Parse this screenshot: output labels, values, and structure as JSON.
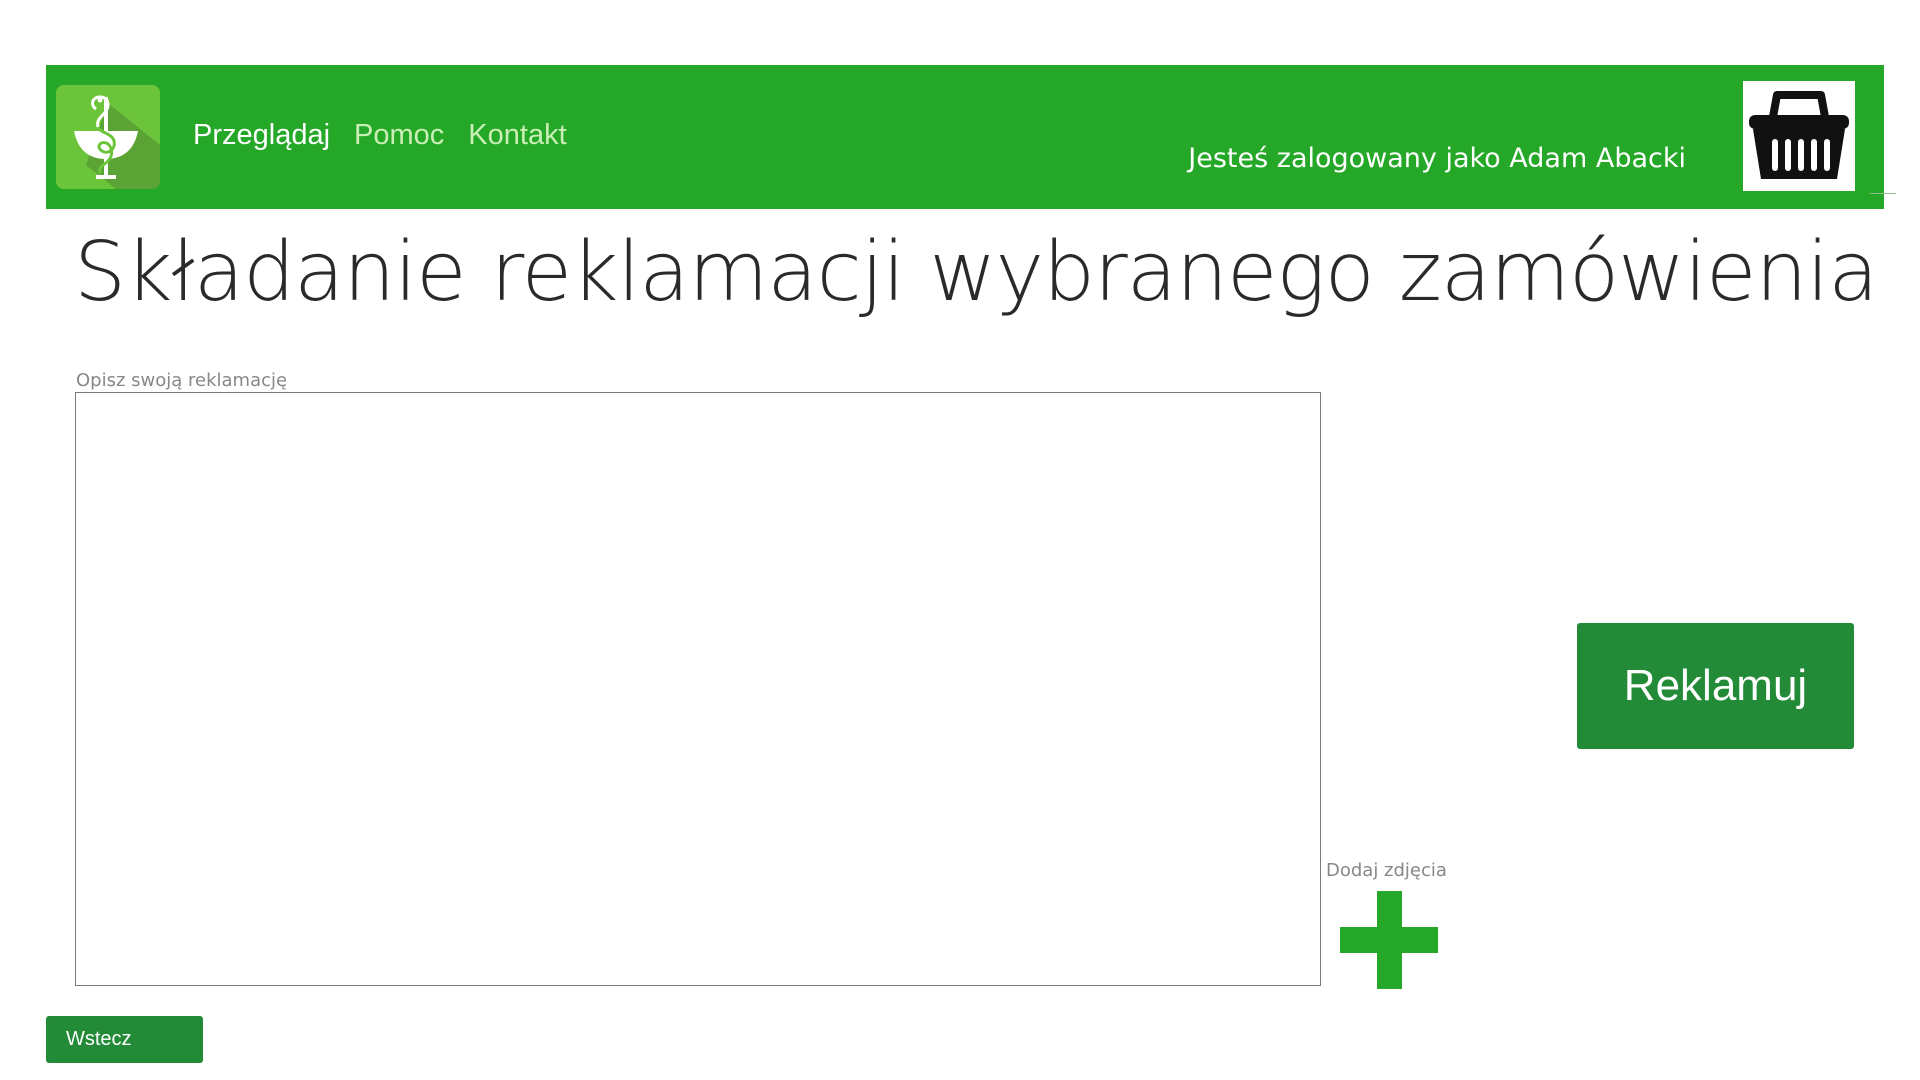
{
  "header": {
    "nav": [
      {
        "label": "Przeglądaj",
        "active": true
      },
      {
        "label": "Pomoc",
        "active": false
      },
      {
        "label": "Kontakt",
        "active": false
      }
    ],
    "user_info": "Jesteś zalogowany jako Adam Abacki",
    "logo_icon": "pharmacy-caduceus-icon",
    "cart_icon": "shopping-basket-icon"
  },
  "main": {
    "title": "Składanie reklamacji wybranego zamówienia",
    "complaint_label": "Opisz swoją reklamację",
    "complaint_value": "",
    "photos_label": "Dodaj zdjęcia",
    "add_photo_icon": "plus-icon",
    "submit_label": "Reklamuj",
    "back_label": "Wstecz"
  },
  "colors": {
    "header_bg": "#25a828",
    "button_bg": "#238b38",
    "nav_active": "#ffffff",
    "nav_inactive": "#c9efb4"
  }
}
